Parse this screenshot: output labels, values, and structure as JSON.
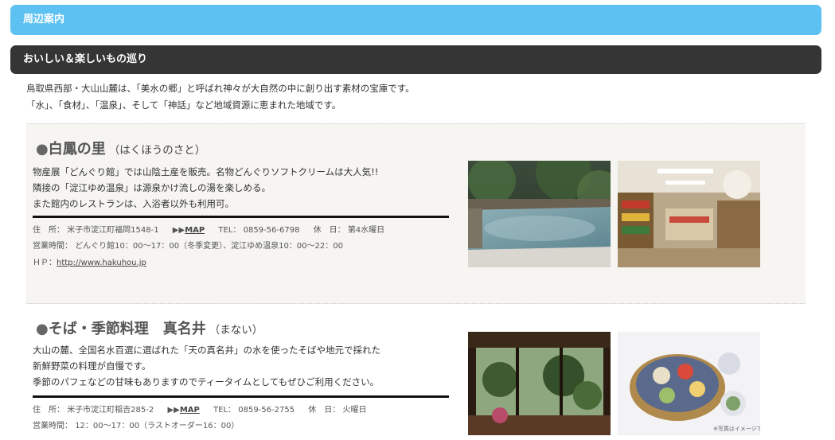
{
  "header": {
    "title": "周辺案内"
  },
  "section": {
    "title": "おいしい＆楽しいもの巡り",
    "intro": [
      "鳥取県西部・大山山麓は、「美水の郷」と呼ばれ神々が大自然の中に創り出す素材の宝庫です。",
      "「水」、「食材」、「温泉」、そして「神話」など地域資源に恵まれた地域です。"
    ]
  },
  "spots": [
    {
      "bullet": "●",
      "name": "白鳳の里",
      "kana": "（はくほうのさと）",
      "desc": [
        "物産展「どんぐり館」では山陰土産を販売。名物どんぐりソフトクリームは大人気!!",
        "隣接の「淀江ゆめ温泉」は源泉かけ流しの湯を楽しめる。",
        "また館内のレストランは、入浴者以外も利用可。"
      ],
      "address_label": "住　所：",
      "address": "米子市淀江町福岡1548-1",
      "map_arrow": "▶▶",
      "map_label": "MAP",
      "tel_label": "TEL：",
      "tel": "0859-56-6798",
      "holiday_label": "休　日：",
      "holiday": "第4水曜日",
      "hours_label": "営業時間：",
      "hours": "どんぐり館10：00～17：00（冬季変更）、淀江ゆめ温泉10：00～22：00",
      "hp_label": "ＨＰ：",
      "hp": "http://www.hakuhou.jp",
      "photos": [
        "outdoor-bath-photo",
        "souvenir-shop-photo"
      ]
    },
    {
      "bullet": "●",
      "name": "そば・季節料理　真名井",
      "kana": "（まない）",
      "desc": [
        "大山の麓、全国名水百選に選ばれた「天の真名井」の水を使ったそばや地元で採れた",
        "新鮮野菜の料理が自慢です。",
        "季節のパフェなどの甘味もありますのでティータイムとしてもぜひご利用ください。"
      ],
      "address_label": "住　所：",
      "address": "米子市淀江町稲吉285-2",
      "map_arrow": "▶▶",
      "map_label": "MAP",
      "tel_label": "TEL：",
      "tel": "0859-56-2755",
      "holiday_label": "休　日：",
      "holiday": "火曜日",
      "hours_label": "営業時間：",
      "hours": "12：00～17：00（ラストオーダー16：00）",
      "photos": [
        "restaurant-interior-photo",
        "seasonal-dish-photo"
      ],
      "photo_caption": "※写真はイメージです"
    }
  ]
}
